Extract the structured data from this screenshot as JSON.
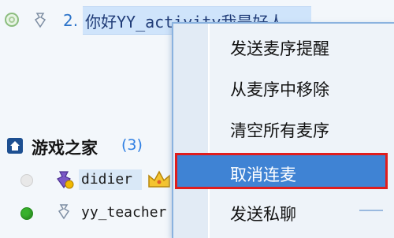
{
  "top_item": {
    "index": "2.",
    "title": "你好YY_activity我是好人"
  },
  "group": {
    "name": "游戏之家",
    "count": "(3)"
  },
  "members": [
    {
      "name": "didier"
    },
    {
      "name": "yy_teacher"
    }
  ],
  "context_menu": {
    "items": [
      {
        "label": "发送麦序提醒"
      },
      {
        "label": "从麦序中移除"
      },
      {
        "label": "清空所有麦序"
      },
      {
        "label": "取消连麦",
        "selected": true
      },
      {
        "label": "发送私聊"
      }
    ]
  },
  "colors": {
    "selected_bg": "#3f83d4",
    "highlight_border": "#e01d1d",
    "link_blue": "#2f7fe3",
    "online_green": "#38b12c"
  },
  "icons": [
    "status-ring-icon",
    "user-icon",
    "home-icon",
    "crown-icon",
    "status-dot-icon"
  ]
}
